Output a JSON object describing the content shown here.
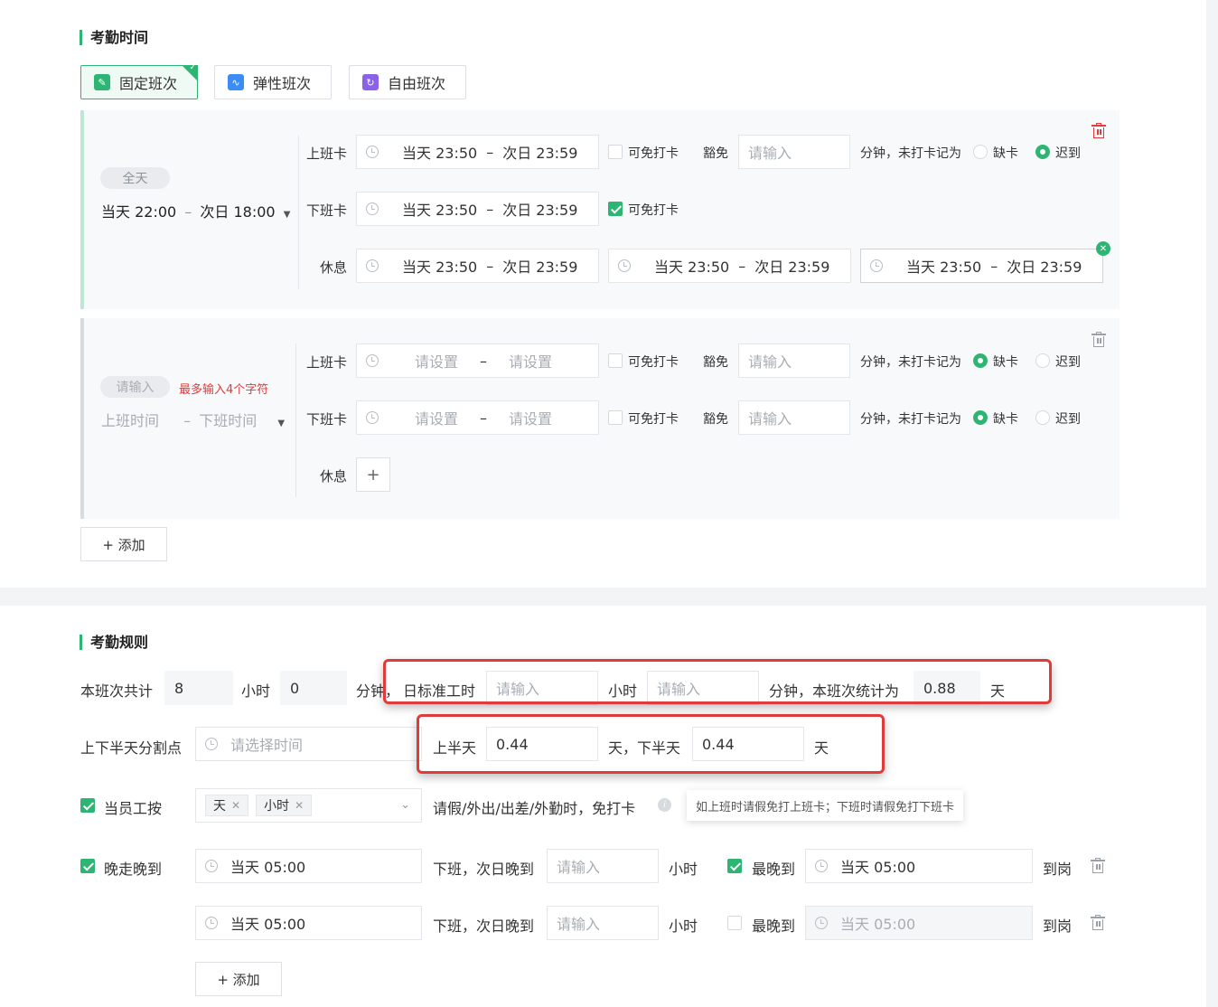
{
  "section_time": {
    "title": "考勤时间",
    "tabs": [
      {
        "label": "固定班次",
        "icon": "pin-icon",
        "active": true
      },
      {
        "label": "弹性班次",
        "icon": "wave-icon",
        "active": false
      },
      {
        "label": "自由班次",
        "icon": "refresh-icon",
        "active": false
      }
    ],
    "shift1": {
      "pill": "全天",
      "range": "当天 22:00",
      "range_sep": "–",
      "range_end": "次日 18:00",
      "clock_in_label": "上班卡",
      "clock_out_label": "下班卡",
      "rest_label": "休息",
      "time_start": "当天 23:50",
      "time_sep": "–",
      "time_end": "次日 23:59",
      "exempt_label": "可免打卡",
      "grace_label": "豁免",
      "grace_placeholder": "请输入",
      "minutes_text": "分钟，未打卡记为",
      "absent_label": "缺卡",
      "late_label": "迟到"
    },
    "shift2": {
      "pill_placeholder": "请输入",
      "error": "最多输入4个字符",
      "start_placeholder": "上班时间",
      "range_sep": "–",
      "end_placeholder": "下班时间",
      "clock_in_label": "上班卡",
      "clock_out_label": "下班卡",
      "rest_label": "休息",
      "set_placeholder": "请设置",
      "time_sep": "–",
      "exempt_label": "可免打卡",
      "grace_label": "豁免",
      "grace_placeholder": "请输入",
      "minutes_text": "分钟，未打卡记为",
      "absent_label": "缺卡",
      "late_label": "迟到",
      "add_rest": "+"
    },
    "add_button": "+ 添加"
  },
  "section_rules": {
    "title": "考勤规则",
    "row1": {
      "total_label": "本班次共计",
      "hours_value": "8",
      "hours_unit": "小时",
      "minutes_value": "0",
      "minutes_unit": "分钟，",
      "std_label": "日标准工时",
      "std_hours_placeholder": "请输入",
      "std_hours_unit": "小时",
      "std_minutes_placeholder": "请输入",
      "stat_text": "分钟，本班次统计为",
      "stat_value": "0.88",
      "stat_unit": "天"
    },
    "row2": {
      "label": "上下半天分割点",
      "placeholder": "请选择时间",
      "first_half_label": "上半天",
      "first_half_value": "0.44",
      "second_half_text": "天，下半天",
      "second_half_value": "0.44",
      "unit": "天"
    },
    "row3": {
      "label": "当员工按",
      "tags": [
        "天",
        "小时"
      ],
      "text": "请假/外出/出差/外勤时，免打卡",
      "tooltip": "如上班时请假免打上班卡；下班时请假免打下班卡"
    },
    "row4": {
      "label": "晚走晚到",
      "time": "当天 05:00",
      "text": "下班，次日晚到",
      "placeholder": "请输入",
      "unit": "小时",
      "latest_label": "最晚到",
      "latest_time": "当天 05:00",
      "arrive": "到岗"
    },
    "row5": {
      "time": "当天 05:00",
      "text": "下班，次日晚到",
      "placeholder": "请输入",
      "unit": "小时",
      "latest_label": "最晚到",
      "latest_time": "当天 05:00",
      "arrive": "到岗"
    },
    "add_button": "+ 添加"
  },
  "colors": {
    "accent": "#2fb573",
    "danger": "#e03a3a",
    "highlight": "#e03a3a"
  }
}
